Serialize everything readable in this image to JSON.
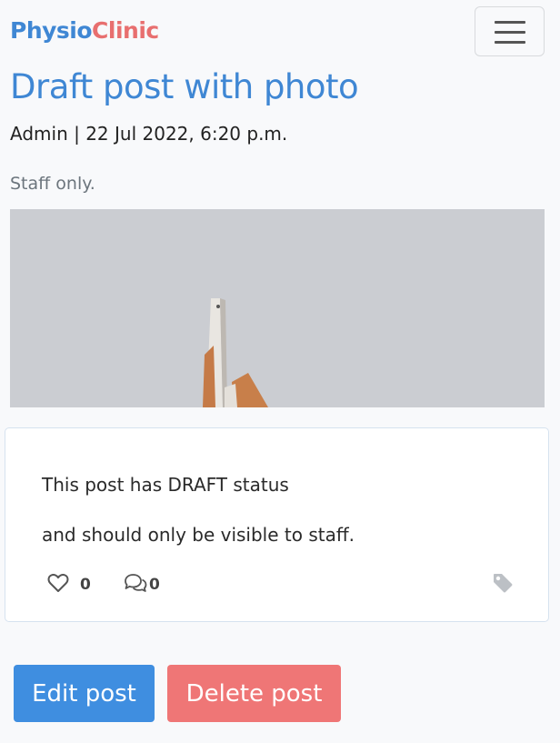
{
  "navbar": {
    "brand_part1": "Physio",
    "brand_part2": "Clinic",
    "brand_color1": "#3f87d4",
    "brand_color2": "#e86f6f",
    "toggle_icon": "hamburger-menu-icon"
  },
  "post": {
    "title": "Draft post with photo",
    "meta": "Admin | 22 Jul 2022, 6:20 p.m.",
    "excerpt": "Staff only.",
    "body_line1": "This post has DRAFT status",
    "body_line2": "and should only be visible to staff.",
    "likes_icon": "heart-icon",
    "likes_count": "0",
    "comments_icon": "comments-icon",
    "comments_count": "0",
    "tag_icon": "tag-icon"
  },
  "actions": {
    "edit_label": "Edit post",
    "delete_label": "Delete post",
    "edit_color": "#3f8ee0",
    "delete_color": "#ef7676"
  }
}
